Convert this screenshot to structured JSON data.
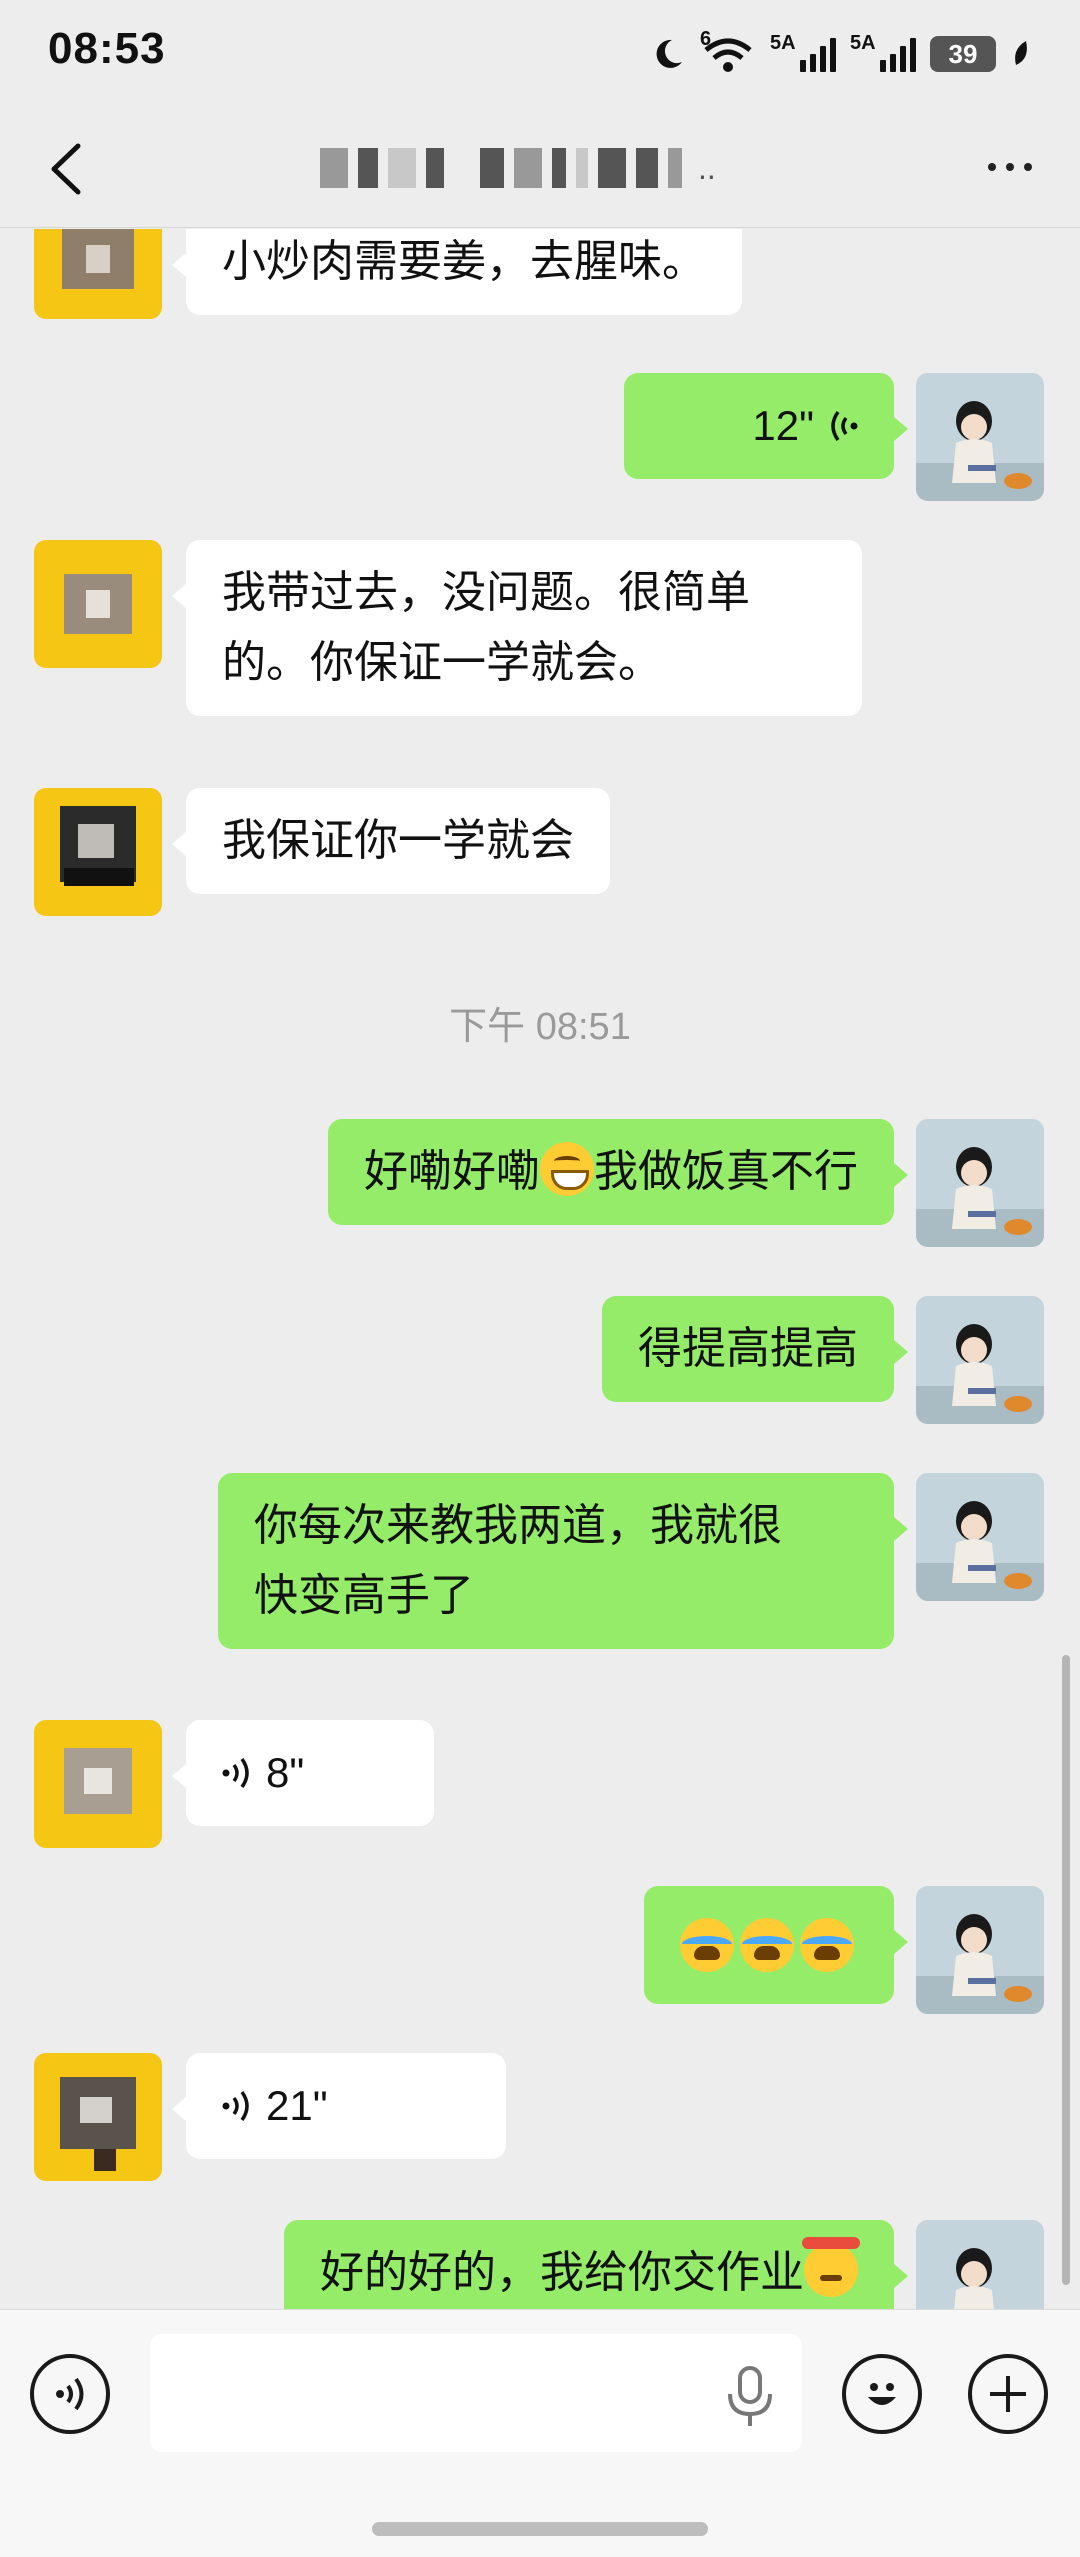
{
  "status_bar": {
    "time": "08:53",
    "signal1_label": "5A",
    "signal2_label": "5A",
    "wifi_label": "6",
    "battery": "39"
  },
  "header": {
    "back_icon": "chevron-left-icon",
    "title_dots": "..",
    "more_icon": "ellipsis-icon"
  },
  "messages": [
    {
      "side": "left",
      "type": "text",
      "text": "小炒肉需要姜，去腥味。"
    },
    {
      "side": "right",
      "type": "voice",
      "duration": "12\""
    },
    {
      "side": "left",
      "type": "text",
      "line1": "我带过去，没问题。很简单",
      "line2": "的。你保证一学就会。"
    },
    {
      "side": "left",
      "type": "text",
      "text": "我保证你一学就会"
    },
    {
      "type": "time",
      "text": "下午 08:51"
    },
    {
      "side": "right",
      "type": "text",
      "before": "好嘞好嘞",
      "after": "我做饭真不行",
      "emoji": "grinning-face"
    },
    {
      "side": "right",
      "type": "text",
      "text": "得提高提高"
    },
    {
      "side": "right",
      "type": "text",
      "line1": "你每次来教我两道，我就很",
      "line2": "快变高手了"
    },
    {
      "side": "left",
      "type": "voice",
      "duration": "8\""
    },
    {
      "side": "right",
      "type": "emoji",
      "emojis": [
        "crying-laughing-face",
        "crying-laughing-face",
        "crying-laughing-face"
      ]
    },
    {
      "side": "left",
      "type": "voice",
      "duration": "21\""
    },
    {
      "side": "right",
      "type": "text",
      "text": "好的好的，我给你交作业",
      "emoji": "thinking-face"
    }
  ],
  "input_bar": {
    "voice_toggle_icon": "voice-icon",
    "mic_icon": "microphone-icon",
    "emoji_icon": "smiley-icon",
    "plus_icon": "plus-icon",
    "placeholder": ""
  }
}
